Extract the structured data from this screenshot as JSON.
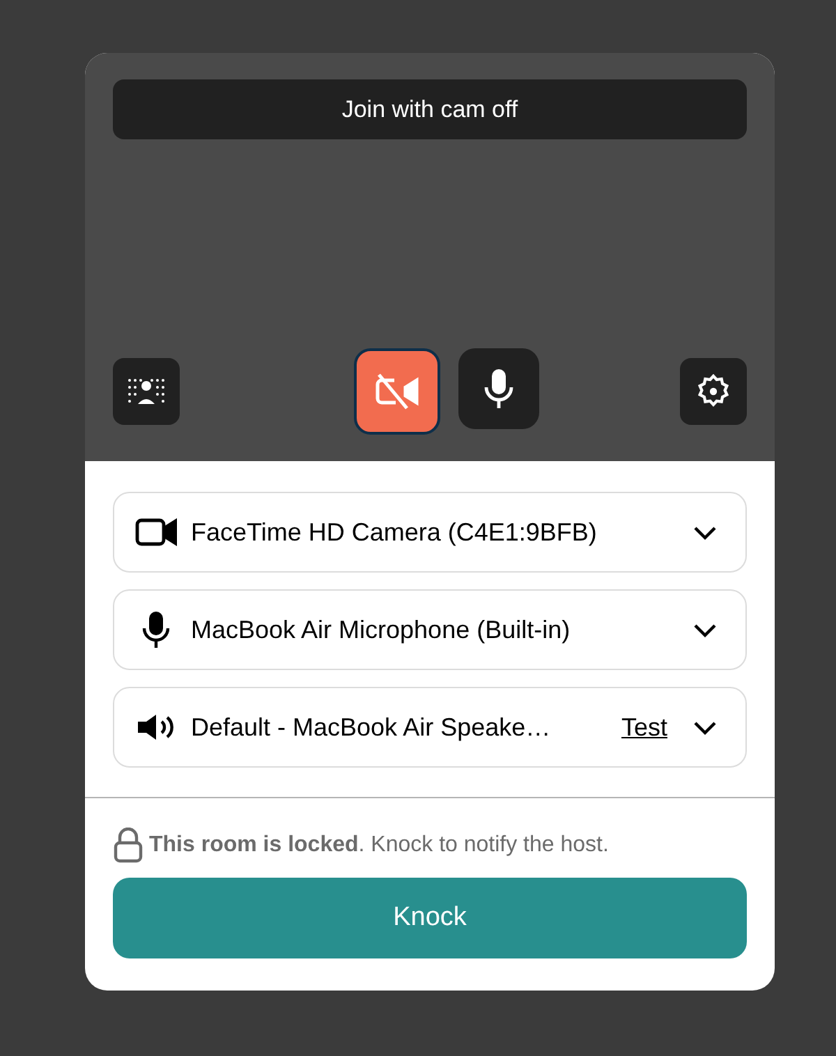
{
  "preview": {
    "join_button": "Join with cam off",
    "camera": {
      "on": false
    },
    "microphone": {
      "on": true
    }
  },
  "devices": [
    {
      "kind": "camera",
      "label": "FaceTime HD Camera (C4E1:9BFB)"
    },
    {
      "kind": "microphone",
      "label": "MacBook Air Microphone (Built-in)"
    },
    {
      "kind": "speaker",
      "label": "Default - MacBook Air Speake…",
      "test_link": "Test"
    }
  ],
  "lock_notice": "**This room is locked**. Knock to notify the host.",
  "knock_button": "Knock"
}
